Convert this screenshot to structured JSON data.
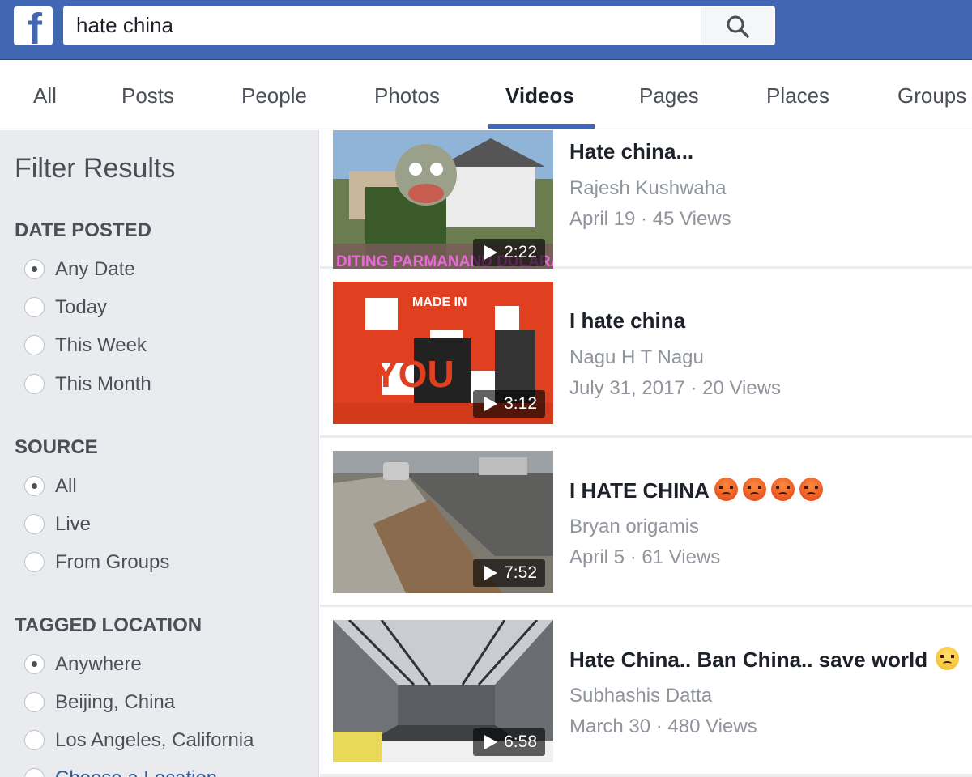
{
  "header": {
    "logo": "f",
    "search_query": "hate china",
    "search_icon": "search-icon"
  },
  "tabs": [
    {
      "label": "All"
    },
    {
      "label": "Posts"
    },
    {
      "label": "People"
    },
    {
      "label": "Photos"
    },
    {
      "label": "Videos",
      "active": true
    },
    {
      "label": "Pages"
    },
    {
      "label": "Places"
    },
    {
      "label": "Groups"
    }
  ],
  "sidebar": {
    "title": "Filter Results",
    "date_posted": {
      "heading": "DATE POSTED",
      "options": [
        "Any Date",
        "Today",
        "This Week",
        "This Month"
      ],
      "selected": "Any Date"
    },
    "source": {
      "heading": "SOURCE",
      "options": [
        "All",
        "Live",
        "From Groups"
      ],
      "selected": "All"
    },
    "tagged_location": {
      "heading": "TAGGED LOCATION",
      "options": [
        "Anywhere",
        "Beijing, China",
        "Los Angeles, California",
        "Choose a Location..."
      ],
      "selected": "Anywhere"
    }
  },
  "videos": [
    {
      "title": "Hate china...",
      "author": "Rajesh Kushwaha",
      "meta": "April 19 · 45 Views",
      "duration": "2:22"
    },
    {
      "title": "I hate china",
      "author": "Nagu H T Nagu",
      "meta": "July 31, 2017 · 20 Views",
      "duration": "3:12"
    },
    {
      "title": "I HATE CHINA",
      "author": "Bryan origamis",
      "meta": "April 5 · 61 Views",
      "duration": "7:52"
    },
    {
      "title": "Hate China.. Ban China.. save world",
      "author": "Subhashis Datta",
      "meta": "March 30 · 480 Views",
      "duration": "6:58"
    }
  ],
  "colors": {
    "brand": "#4267b2",
    "sidebar_bg": "#e9ebee",
    "muted_text": "#90949c"
  }
}
